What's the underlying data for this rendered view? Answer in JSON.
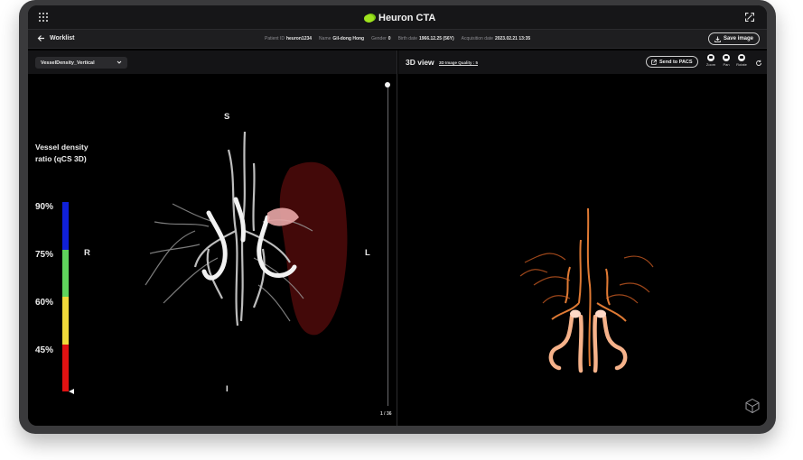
{
  "app": {
    "name": "Heuron CTA"
  },
  "icons": {
    "apps": "grid-icon",
    "fullscreen": "fullscreen-icon",
    "back": "arrow-left-icon",
    "save": "download-icon",
    "send": "external-link-icon",
    "zoom": "zoom-icon",
    "pan": "pan-icon",
    "rotate": "rotate-icon",
    "reset": "reset-icon",
    "orientation_cube": "cube-icon"
  },
  "header": {
    "back_label": "Worklist",
    "patient": [
      {
        "key": "Patient ID",
        "value": "heuron1234"
      },
      {
        "key": "Name",
        "value": "Gil-dong Hong"
      },
      {
        "key": "Gender",
        "value": "0"
      },
      {
        "key": "Birth date",
        "value": "1966.12.25 (56Y)"
      },
      {
        "key": "Acquisition date",
        "value": "2023.02.21 13:35"
      }
    ],
    "save_label": "Save image"
  },
  "left_panel": {
    "view_select": "VesselDensity_Vertical",
    "legend": {
      "title": "Vessel density ratio (qCS 3D)",
      "ticks": [
        "90%",
        "75%",
        "60%",
        "45%"
      ],
      "colors": [
        "#1020d8",
        "#5fd45c",
        "#f0d93a",
        "#e01212"
      ]
    },
    "orientation": {
      "top": "S",
      "bottom": "I",
      "left": "R",
      "right": "L"
    },
    "slice_counter": "1 / 36"
  },
  "right_panel": {
    "title": "3D view",
    "quality": "3D Image Quality : 5",
    "send_label": "Send to PACS",
    "tools": [
      "Zoom",
      "Pan",
      "Rotate"
    ]
  },
  "colors": {
    "device_frame": "#3a3a3c",
    "background": "#000000",
    "brand_green": "#9fe31e",
    "vessel_render": "#f28c3c"
  }
}
